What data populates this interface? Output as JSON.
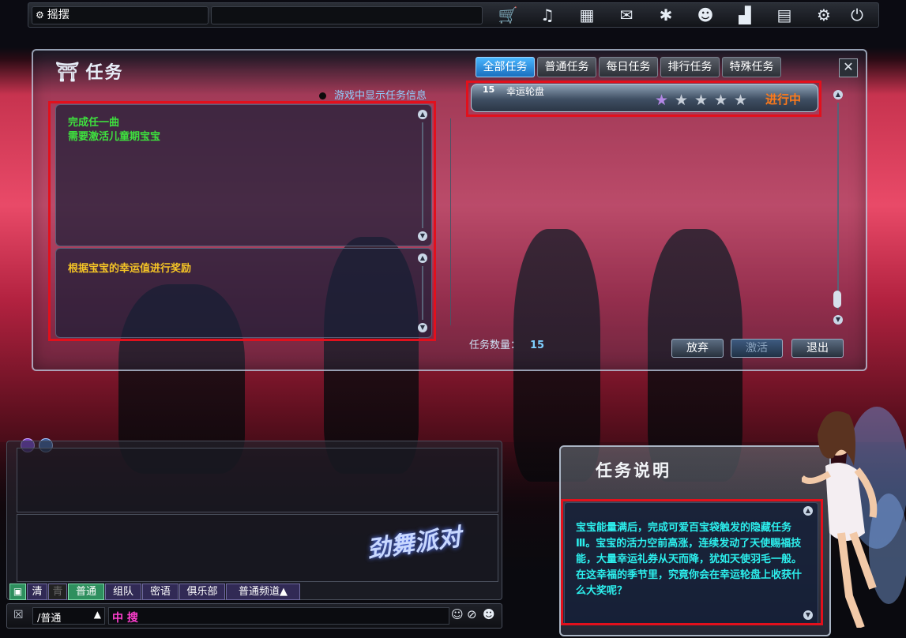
{
  "topbar": {
    "location_label": "摇摆",
    "icons": [
      "shop-cart-icon",
      "music-icon",
      "box-icon",
      "chat-bubble-icon",
      "dance-icon",
      "couple-icon",
      "podium-icon",
      "book-icon",
      "gear-icon",
      "power-icon"
    ]
  },
  "quest_panel": {
    "title": "任务",
    "tabs": [
      {
        "label": "全部任务",
        "active": true
      },
      {
        "label": "普通任务",
        "active": false
      },
      {
        "label": "每日任务",
        "active": false
      },
      {
        "label": "排行任务",
        "active": false
      },
      {
        "label": "特殊任务",
        "active": false
      }
    ],
    "show_info_label": "游戏中显示任务信息",
    "objective_lines": [
      "完成任一曲",
      "需要激活儿童期宝宝"
    ],
    "reward_text": "根据宝宝的幸运值进行奖励",
    "quest_item": {
      "level": "15",
      "name": "幸运轮盘",
      "stars_filled": 1,
      "stars_total": 5,
      "status": "进行中"
    },
    "count_label": "任务数量：",
    "count_value": "15",
    "buttons": {
      "abandon": "放弃",
      "activate": "激活",
      "exit": "退出"
    }
  },
  "chat": {
    "channels": [
      "清",
      "青",
      "普通",
      "组队",
      "密语",
      "俱乐部",
      "普通频道▲"
    ],
    "input_channel": "/普通",
    "input_mode": "中 搜"
  },
  "description_panel": {
    "title": "任务说明",
    "text": "宝宝能量满后，完成可爱百宝袋触发的隐藏任务Ⅲ。宝宝的活力空前高涨，连续发动了天使赐福技能，大量幸运礼券从天而降，犹如天使羽毛一般。在这幸福的季节里，究竟你会在幸运轮盘上收获什么大奖呢？"
  },
  "colors": {
    "highlight": "#e2101c",
    "objective": "#3ee13e",
    "reward": "#f7c625",
    "description": "#2cf0ee",
    "status": "#ff7a1a"
  }
}
